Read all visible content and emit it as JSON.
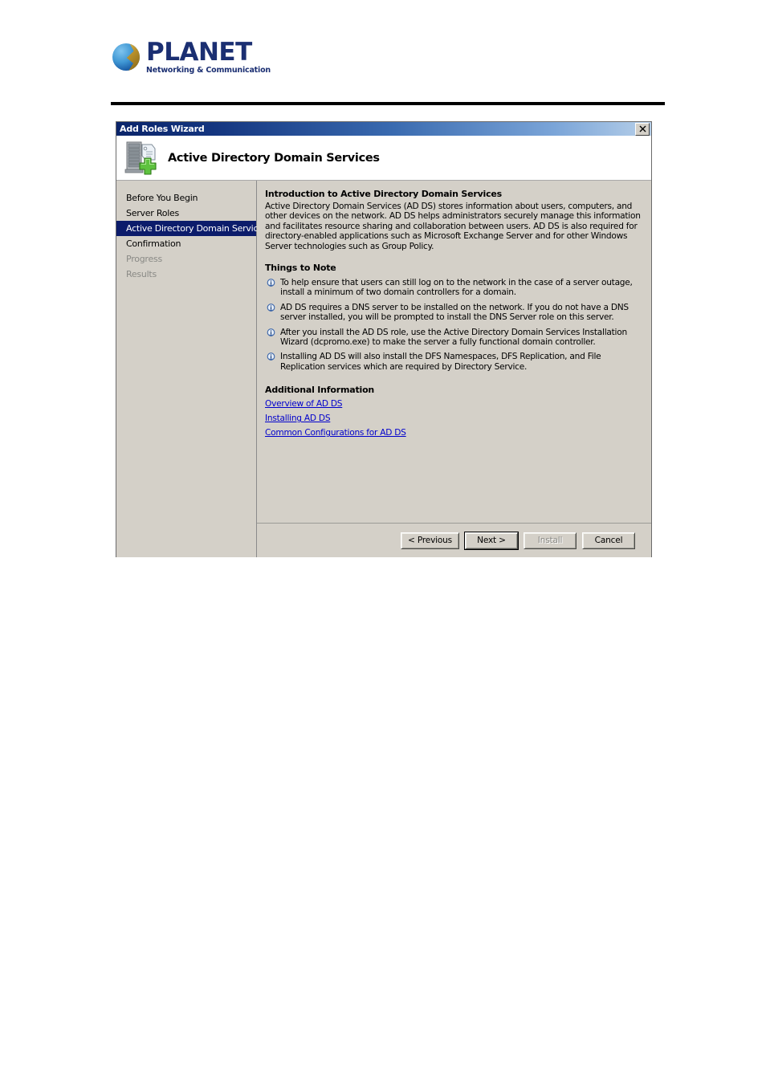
{
  "brand": {
    "name": "PLANET",
    "tagline": "Networking & Communication",
    "logo_icon": "planet-sphere-icon",
    "color": "#1b2f72"
  },
  "dialog": {
    "titlebar": {
      "title": "Add Roles Wizard",
      "close_label": "✕",
      "close_icon": "close-icon",
      "gradient_start": "#0a246a",
      "gradient_end": "#b6cfe9"
    },
    "banner": {
      "icon": "server-with-tag-and-plus-icon",
      "title": "Active Directory Domain Services"
    },
    "sidebar": {
      "items": [
        {
          "label": "Before You Begin",
          "state": "normal"
        },
        {
          "label": "Server Roles",
          "state": "normal"
        },
        {
          "label": "Active Directory Domain Services",
          "state": "active"
        },
        {
          "label": "Confirmation",
          "state": "normal"
        },
        {
          "label": "Progress",
          "state": "disabled"
        },
        {
          "label": "Results",
          "state": "disabled"
        }
      ],
      "active_background": "#0c1c6b",
      "disabled_color": "#8a8a86"
    },
    "content": {
      "intro_heading": "Introduction to Active Directory Domain Services",
      "intro_paragraph": "Active Directory Domain Services (AD DS) stores information about users, computers, and other devices on the network. AD DS helps administrators securely manage this information and facilitates resource sharing and collaboration between users. AD DS is also required for directory-enabled applications such as Microsoft Exchange Server and for other Windows Server technologies such as Group Policy.",
      "notes_heading": "Things to Note",
      "notes": [
        "To help ensure that users can still log on to the network in the case of a server outage, install a minimum of two domain controllers for a domain.",
        "AD DS requires a DNS server to be installed on the network. If you do not have a DNS server installed, you will be prompted to install the DNS Server role on this server.",
        "After you install the AD DS role, use the Active Directory Domain Services Installation Wizard (dcpromo.exe) to make the server a fully functional domain controller.",
        "Installing AD DS will also install the DFS Namespaces, DFS Replication, and File Replication services which are required by Directory Service."
      ],
      "note_icon": "info-icon",
      "additional_heading": "Additional Information",
      "links": [
        "Overview of AD DS",
        "Installing AD DS",
        "Common Configurations for AD DS"
      ],
      "link_color": "#0000cc"
    },
    "footer": {
      "buttons": [
        {
          "label": "< Previous",
          "state": "normal"
        },
        {
          "label": "Next >",
          "state": "default"
        },
        {
          "label": "Install",
          "state": "disabled"
        },
        {
          "label": "Cancel",
          "state": "normal"
        }
      ]
    }
  }
}
